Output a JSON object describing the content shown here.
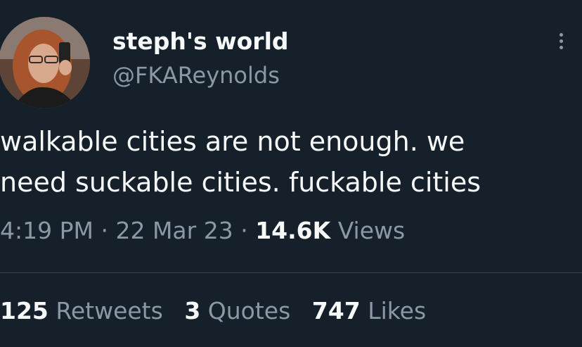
{
  "tweet": {
    "author": {
      "display_name": "steph's world",
      "handle": "@FKAReynolds"
    },
    "text_lines": [
      "walkable cities are not enough. we",
      "need suckable cities. fuckable cities"
    ],
    "meta": {
      "time": "4:19 PM",
      "separator": "·",
      "date": "22 Mar 23",
      "views_count": "14.6K",
      "views_label": "Views"
    },
    "stats": {
      "retweets_count": "125",
      "retweets_label": "Retweets",
      "quotes_count": "3",
      "quotes_label": "Quotes",
      "likes_count": "747",
      "likes_label": "Likes"
    }
  },
  "icons": {
    "more": "more-vertical-icon"
  },
  "colors": {
    "background": "#15202b",
    "primary_text": "#f7f9f9",
    "secondary_text": "#8b98a5",
    "divider": "#38444d"
  }
}
